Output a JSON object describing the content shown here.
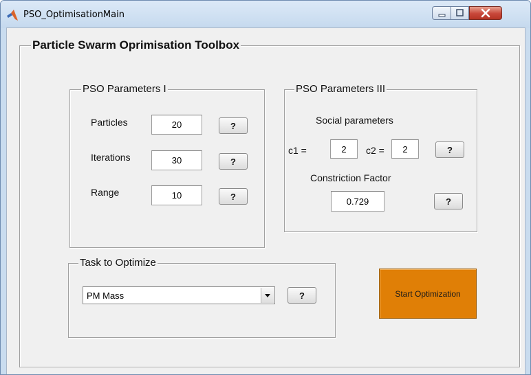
{
  "window": {
    "title": "PSO_OptimisationMain",
    "caption_buttons": [
      "minimize-icon",
      "maximize-icon",
      "close-icon"
    ]
  },
  "main_panel": {
    "title": "Particle Swarm Oprimisation Toolbox"
  },
  "params1": {
    "title": "PSO Parameters I",
    "particles_label": "Particles",
    "particles_value": "20",
    "iterations_label": "Iterations",
    "iterations_value": "30",
    "range_label": "Range",
    "range_value": "10",
    "help_label": "?"
  },
  "params3": {
    "title": "PSO Parameters III",
    "social_label": "Social parameters",
    "c1_label": "c1 =",
    "c1_value": "2",
    "c2_label": "c2 =",
    "c2_value": "2",
    "constriction_label": "Constriction Factor",
    "constriction_value": "0.729",
    "help_label": "?"
  },
  "task": {
    "title": "Task to Optimize",
    "selected": "PM Mass",
    "help_label": "?"
  },
  "start_button_label": "Start Optimization",
  "colors": {
    "start_button": "#e07f06",
    "window_frame": "#c9dcef",
    "close_button": "#c8473a"
  }
}
